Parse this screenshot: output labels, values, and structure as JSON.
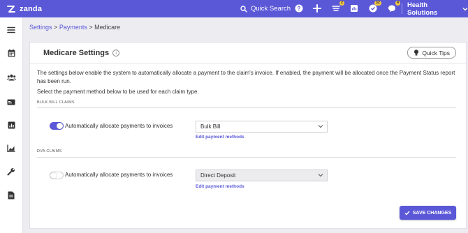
{
  "app": {
    "logo_text": "zanda",
    "brand_color": "#5b58d8"
  },
  "topbar": {
    "search_label": "Quick Search",
    "icons": [
      "help-icon",
      "add-icon",
      "tasks-icon",
      "reports-icon",
      "checklist-icon",
      "chat-icon"
    ],
    "badges": {
      "tasks": "2",
      "checklist": "32",
      "chat": "4"
    },
    "org_name": "Health Solutions"
  },
  "sidebar": {
    "items": [
      "menu-icon",
      "calendar-icon",
      "clients-icon",
      "billing-icon",
      "reports-icon",
      "analytics-icon",
      "settings-icon",
      "document-icon"
    ]
  },
  "breadcrumb": {
    "items": [
      "Settings",
      "Payments"
    ],
    "separator": ">",
    "current": "Medicare"
  },
  "card": {
    "title": "Medicare Settings",
    "quick_tips_label": "Quick Tips",
    "description": "The settings below enable the system to automatically allocate a payment to the claim's invoice. If enabled, the payment will be allocated once the Payment Status report has been run.",
    "instruction": "Select the payment method below to be used for each claim type.",
    "sections": [
      {
        "label": "BULK BILL CLAIMS",
        "toggle_label": "Automatically allocate payments to invoices",
        "toggle_on": true,
        "select_value": "Bulk Bill",
        "select_disabled": false,
        "edit_link": "Edit payment methods"
      },
      {
        "label": "DVA CLAIMS",
        "toggle_label": "Automatically allocate payments to invoices",
        "toggle_on": false,
        "select_value": "Direct Deposit",
        "select_disabled": true,
        "edit_link": "Edit payment methods"
      }
    ],
    "save_label": "SAVE CHANGES"
  }
}
